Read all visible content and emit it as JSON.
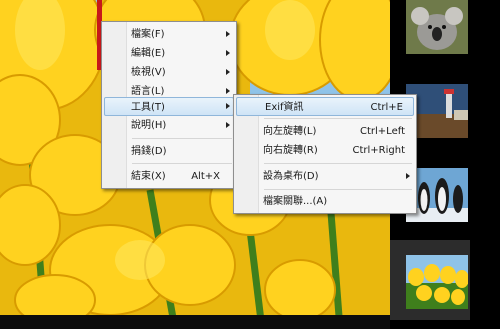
{
  "main_menu": {
    "items": [
      {
        "label": "檔案(F)",
        "submenu": true
      },
      {
        "label": "編輯(E)",
        "submenu": true
      },
      {
        "label": "檢視(V)",
        "submenu": true
      },
      {
        "label": "語言(L)",
        "submenu": true
      },
      {
        "label": "工具(T)",
        "submenu": true,
        "highlighted": true
      },
      {
        "label": "說明(H)",
        "submenu": true
      },
      {
        "label": "捐錢(D)"
      },
      {
        "label": "結束(X)",
        "shortcut": "Alt+X"
      }
    ]
  },
  "tools_submenu": {
    "items": [
      {
        "label": "Exif資訊",
        "shortcut": "Ctrl+E",
        "highlighted": true
      },
      {
        "label": "向左旋轉(L)",
        "shortcut": "Ctrl+Left"
      },
      {
        "label": "向右旋轉(R)",
        "shortcut": "Ctrl+Right"
      },
      {
        "label": "設為桌布(D)",
        "submenu": true
      },
      {
        "label": "檔案關聯...(A)"
      }
    ]
  },
  "thumbnails": [
    "koala",
    "lighthouse",
    "penguins",
    "tulips"
  ],
  "colors": {
    "menu_bg": "#f6f6f6",
    "highlight": "#cfe4f6",
    "highlight_border": "#8fb6da"
  }
}
